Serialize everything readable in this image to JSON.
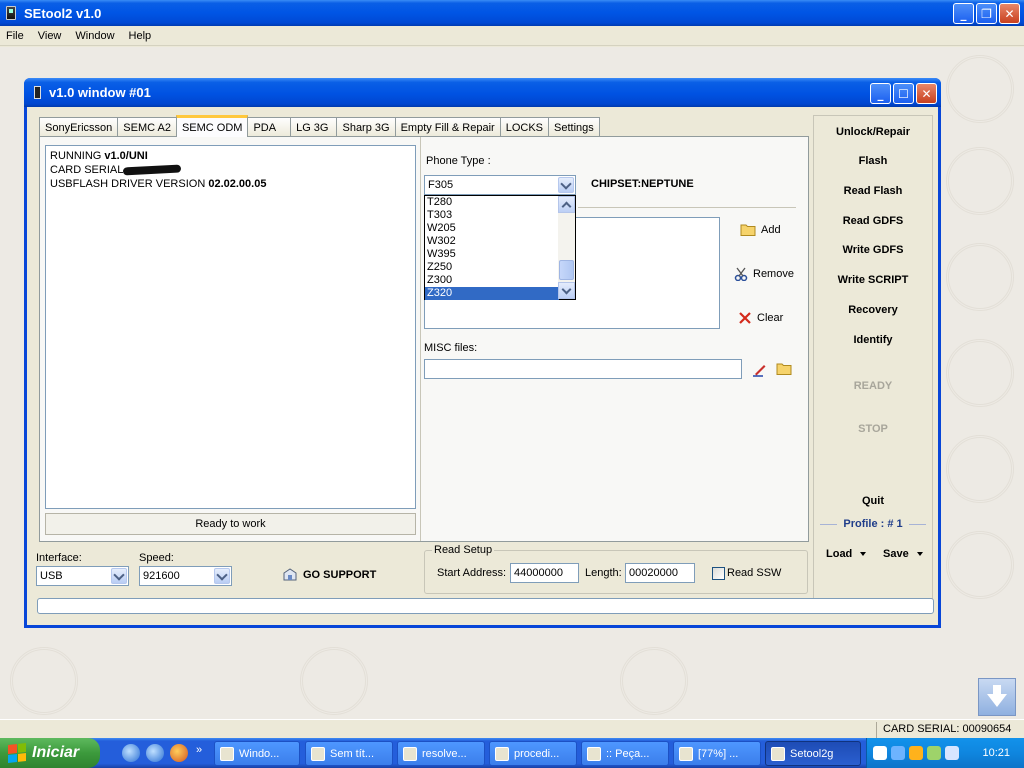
{
  "app": {
    "title": "SEtool2 v1.0",
    "menu": [
      "File",
      "View",
      "Window",
      "Help"
    ]
  },
  "child": {
    "title": "v1.0 window #01",
    "tabs": [
      "SonyEricsson",
      "SEMC A2",
      "SEMC ODM",
      "PDA",
      "LG 3G",
      "Sharp 3G",
      "Empty Fill & Repair",
      "LOCKS",
      "Settings"
    ],
    "active_tab": "SEMC ODM",
    "log": {
      "line1_prefix": "RUNNING ",
      "line1_bold": "v1.0/UNI",
      "line2_prefix": "CARD SERIAL",
      "line3_prefix": "USBFLASH DRIVER VERSION ",
      "line3_bold": "02.02.00.05"
    },
    "status": "Ready to work",
    "phone_type_label": "Phone Type :",
    "phone_type_value": "F305",
    "chipset": "CHIPSET:NEPTUNE",
    "phone_options": [
      "T280",
      "T303",
      "W205",
      "W302",
      "W395",
      "Z250",
      "Z300",
      "Z320"
    ],
    "selected_option": "Z320",
    "add_label": "Add",
    "remove_label": "Remove",
    "clear_label": "Clear",
    "misc_label": "MISC files:",
    "misc_value": "",
    "right_buttons": [
      "Unlock/Repair",
      "Flash",
      "Read Flash",
      "Read GDFS",
      "Write GDFS",
      "Write SCRIPT",
      "Recovery",
      "Identify"
    ],
    "ready_label": "READY",
    "stop_label": "STOP",
    "quit_label": "Quit",
    "profile_label": "Profile : # 1",
    "load_label": "Load",
    "save_label": "Save",
    "interface_label": "Interface:",
    "interface_value": "USB",
    "speed_label": "Speed:",
    "speed_value": "921600",
    "go_support_label": "GO SUPPORT",
    "read_setup": {
      "legend": "Read Setup",
      "start_label": "Start Address:",
      "start_value": "44000000",
      "length_label": "Length:",
      "length_value": "00020000",
      "ssw_label": "Read SSW",
      "ssw_checked": false
    },
    "progress": 0
  },
  "statusbar": {
    "card_serial": "CARD SERIAL: 00090654"
  },
  "taskbar": {
    "start_label": "Iniciar",
    "quick_chevron": "»",
    "tasks": [
      "Windo...",
      "Sem tít...",
      "resolve...",
      "procedi...",
      ":: Peça...",
      "[77%] ...",
      "Setool2g"
    ],
    "active_task": "Setool2g",
    "clock": "10:21"
  },
  "colors": {
    "xp_blue": "#0055e5",
    "selection": "#316ac5",
    "tab_highlight": "#ffc83c",
    "profile_text": "#1f3d8a",
    "start_green": "#3c9a3c"
  },
  "icons": {
    "add": "folder-icon",
    "remove": "scissors-icon",
    "clear": "red-x-icon",
    "misc_edit": "pencil-icon",
    "misc_browse": "folder-icon",
    "go_support": "support-icon"
  }
}
